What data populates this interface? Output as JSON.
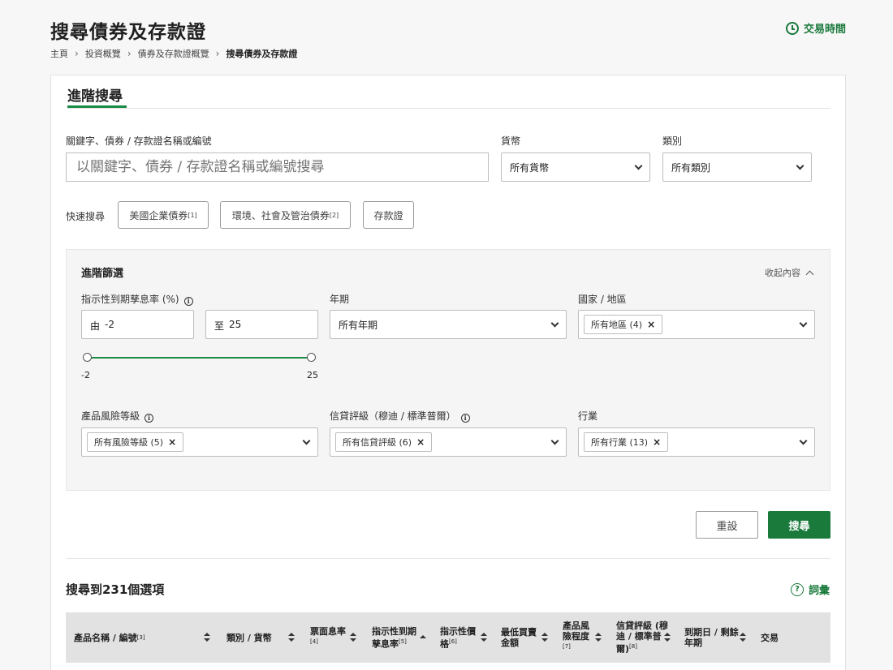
{
  "header": {
    "title": "搜尋債券及存款證",
    "trade_time": "交易時間"
  },
  "breadcrumb": [
    "主頁",
    "投資概覽",
    "債券及存款證概覽",
    "搜尋債券及存款證"
  ],
  "search": {
    "tab": "進階搜尋",
    "keyword_label": "關鍵字、債券 / 存款證名稱或編號",
    "keyword_placeholder": "以關鍵字、債券 / 存款證名稱或編號搜尋",
    "currency_label": "貨幣",
    "currency_value": "所有貨幣",
    "category_label": "類別",
    "category_value": "所有類別",
    "quick_label": "快速搜尋",
    "quick_buttons": [
      {
        "label": "美國企業債券",
        "note": "[1]"
      },
      {
        "label": "環境、社會及管治債券",
        "note": "[2]"
      },
      {
        "label": "存款證",
        "note": ""
      }
    ]
  },
  "filters": {
    "title": "進階篩選",
    "collapse": "收起內容",
    "yield_label": "指示性到期孳息率 (%)",
    "from_prefix": "由",
    "from_value": "-2",
    "to_prefix": "至",
    "to_value": "25",
    "slider_min": "-2",
    "slider_max": "25",
    "tenor_label": "年期",
    "tenor_value": "所有年期",
    "region_label": "國家 / 地區",
    "region_chip": "所有地區 (4)",
    "risk_label": "產品風險等級",
    "risk_chip": "所有風險等級 (5)",
    "rating_label": "信貸評級（穆迪 / 標準普爾）",
    "rating_chip": "所有信貸評級 (6)",
    "industry_label": "行業",
    "industry_chip": "所有行業 (13)"
  },
  "actions": {
    "reset": "重設",
    "search": "搜尋"
  },
  "results": {
    "count_text": "搜尋到231個選項",
    "glossary": "詞彙",
    "columns": {
      "c1": "產品名稱 / 編號",
      "c1n": "[3]",
      "c2": "類別 / 貨幣",
      "c3a": "票面息率",
      "c3n": "[4]",
      "c4a": "指示性到期",
      "c4b": "孳息率",
      "c4n": "[5]",
      "c5a": "指示性價",
      "c5b": "格",
      "c5n": "[6]",
      "c6a": "最低買賣",
      "c6b": "金額",
      "c7a": "產品風",
      "c7b": "險程度",
      "c7n": "[7]",
      "c8a": "信貸評級 (穆",
      "c8b": "迪 / 標準普",
      "c8c": "爾)",
      "c8n": "[8]",
      "c9a": "到期日 / 剩餘",
      "c9b": "年期",
      "c10": "交易"
    }
  }
}
